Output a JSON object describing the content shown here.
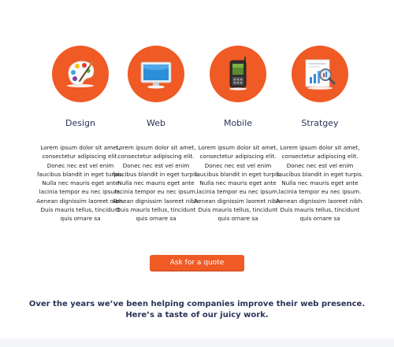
{
  "services": [
    {
      "title": "Design",
      "icon": "palette-icon",
      "body": "Lorem ipsum dolor sit amet, consectetur adipiscing elit. Donec nec est vel enim faucibus blandit in eget turpis. Nulla nec mauris eget ante lacinia tempor eu nec ipsum. Aenean dignissim laoreet nibh. Duis mauris tellus, tincidunt quis ornare sa"
    },
    {
      "title": "Web",
      "icon": "monitor-icon",
      "body": "Lorem ipsum dolor sit amet, consectetur adipiscing elit. Donec nec est vel enim faucibus blandit in eget turpis. Nulla nec mauris eget ante lacinia tempor eu nec ipsum. Aenean dignissim laoreet nibh. Duis mauris tellus, tincidunt quis ornare sa"
    },
    {
      "title": "Mobile",
      "icon": "phone-icon",
      "body": "Lorem ipsum dolor sit amet, consectetur adipiscing elit. Donec nec est vel enim faucibus blandit in eget turpis. Nulla nec mauris eget ante lacinia tempor eu nec ipsum. Aenean dignissim laoreet nibh. Duis mauris tellus, tincidunt quis ornare sa"
    },
    {
      "title": "Stratgey",
      "icon": "chart-magnifier-icon",
      "body": "Lorem ipsum dolor sit amet, consectetur adipiscing elit. Donec nec est vel enim faucibus blandit in eget turpis. Nulla nec mauris eget ante lacinia tempor eu nec ipsum. Aenean dignissim laoreet nibh. Duis mauris tellus, tincidunt quis ornare sa"
    }
  ],
  "cta": {
    "label": "Ask for a quote"
  },
  "tagline": {
    "line1": "Over the years we’ve been helping companies improve their web presence.",
    "line2": "Here’s a taste of our juicy work."
  },
  "colors": {
    "accent": "#f05a24",
    "heading": "#2a3358"
  }
}
